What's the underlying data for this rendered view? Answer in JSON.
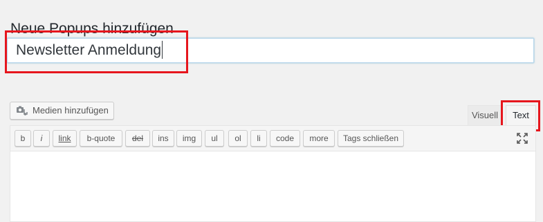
{
  "page": {
    "title": "Neue Popups hinzufügen"
  },
  "title_field": {
    "value": "Newsletter Anmeldung"
  },
  "media": {
    "button_label": "Medien hinzufügen",
    "icon": "media-camera-icon"
  },
  "editor_tabs": {
    "visual": "Visuell",
    "text": "Text",
    "active": "text"
  },
  "quicktags": [
    {
      "label": "b"
    },
    {
      "label": "i"
    },
    {
      "label": "link"
    },
    {
      "label": "b-quote"
    },
    {
      "label": "del"
    },
    {
      "label": "ins"
    },
    {
      "label": "img"
    },
    {
      "label": "ul"
    },
    {
      "label": "ol"
    },
    {
      "label": "li"
    },
    {
      "label": "code"
    },
    {
      "label": "more"
    },
    {
      "label": "Tags schließen"
    }
  ],
  "content": {
    "body": ""
  },
  "colors": {
    "highlight": "#e6161d",
    "background": "#f1f1f1",
    "focus_border": "#b9d7ec"
  }
}
